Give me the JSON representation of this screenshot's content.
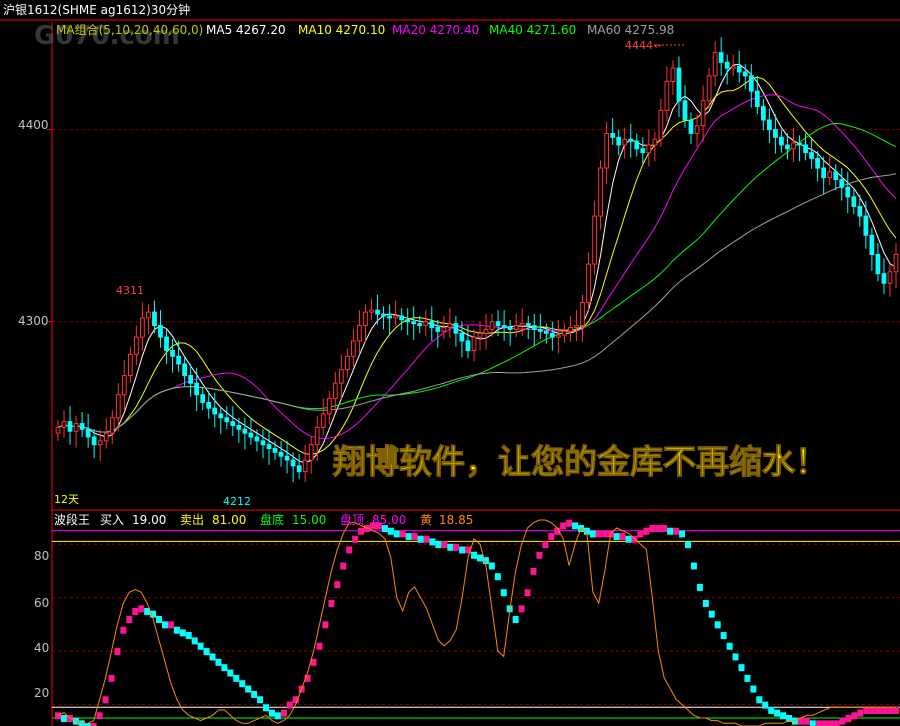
{
  "title_bar": {
    "title": "沪银1612(SHME ag1612)30分钟",
    "watermark": "G070.com"
  },
  "ma_legend": [
    {
      "label": "MA组合(5,10,20,40,60,0)",
      "color": "#c8c800"
    },
    {
      "label": "MA5 4267.20",
      "color": "#ffffff"
    },
    {
      "label": "MA10 4270.10",
      "color": "#ffff00"
    },
    {
      "label": "MA20 4270.40",
      "color": "#ff00ff"
    },
    {
      "label": "MA40 4271.60",
      "color": "#00ff00"
    },
    {
      "label": "MA60 4275.98",
      "color": "#a0a0a0"
    }
  ],
  "main_panel": {
    "y_ticks": [
      "4400",
      "4300"
    ],
    "high_label": "4444",
    "left_high_label": "4311",
    "low_label": "4212",
    "period_label": "12天",
    "slogan": "翔博软件，让您的金库不再缩水！"
  },
  "sub_panel": {
    "name": "波段王",
    "params": [
      {
        "label": "买入",
        "value": "19.00",
        "color": "#ffffff"
      },
      {
        "label": "卖出",
        "value": "81.00",
        "color": "#ffff00"
      },
      {
        "label": "盘底",
        "value": "15.00",
        "color": "#00ff00"
      },
      {
        "label": "盘顶",
        "value": "85.00",
        "color": "#ff00ff"
      },
      {
        "label": "黄",
        "value": "18.85",
        "color": "#ff8800"
      }
    ],
    "y_ticks": [
      "80",
      "60",
      "40",
      "20"
    ]
  },
  "colors": {
    "up": "#ff3232",
    "down": "#00ffff",
    "grid": "#8b0000",
    "axis": "#ff0000",
    "ma5": "#ffffff",
    "ma10": "#ffff00",
    "ma20": "#ff00ff",
    "ma40": "#00ff00",
    "ma60": "#a0a0a0",
    "osc_up": "#ff1493",
    "osc_down": "#00ffff",
    "osc_line": "#ff8800",
    "slogan": "#ffff00"
  },
  "chart_data": [
    {
      "type": "candlestick",
      "title": "沪银1612(SHME ag1612)30分钟",
      "ylim": [
        4202,
        4456
      ],
      "y_ticks": [
        4300,
        4400
      ],
      "key_levels": {
        "high": 4444,
        "local_high": 4311,
        "low": 4212
      },
      "closes": [
        4245,
        4248,
        4243,
        4247,
        4244,
        4240,
        4236,
        4238,
        4242,
        4250,
        4262,
        4272,
        4283,
        4292,
        4302,
        4305,
        4298,
        4292,
        4285,
        4282,
        4278,
        4272,
        4268,
        4262,
        4258,
        4255,
        4252,
        4250,
        4248,
        4246,
        4244,
        4242,
        4240,
        4238,
        4236,
        4234,
        4232,
        4230,
        4228,
        4225,
        4222,
        4228,
        4236,
        4245,
        4252,
        4260,
        4268,
        4275,
        4282,
        4290,
        4298,
        4305,
        4306,
        4304,
        4303,
        4302,
        4303,
        4301,
        4300,
        4299,
        4298,
        4300,
        4297,
        4295,
        4297,
        4299,
        4294,
        4290,
        4285,
        4292,
        4294,
        4296,
        4300,
        4298,
        4297,
        4296,
        4298,
        4299,
        4298,
        4296,
        4295,
        4294,
        4292,
        4293,
        4295,
        4297,
        4298,
        4310,
        4330,
        4355,
        4380,
        4398,
        4396,
        4392,
        4395,
        4394,
        4390,
        4388,
        4392,
        4395,
        4410,
        4425,
        4432,
        4415,
        4405,
        4398,
        4402,
        4415,
        4428,
        4440,
        4435,
        4432,
        4433,
        4430,
        4428,
        4420,
        4412,
        4405,
        4400,
        4396,
        4392,
        4390,
        4393,
        4392,
        4388,
        4385,
        4380,
        4375,
        4378,
        4374,
        4370,
        4365,
        4360,
        4355,
        4345,
        4335,
        4325,
        4320,
        4326,
        4335
      ],
      "ma_series": [
        "MA5",
        "MA10",
        "MA20",
        "MA40",
        "MA60"
      ],
      "ma_values": {
        "MA5": 4267.2,
        "MA10": 4270.1,
        "MA20": 4270.4,
        "MA40": 4271.6,
        "MA60": 4275.98
      }
    },
    {
      "type": "bar",
      "title": "波段王",
      "ylim": [
        12,
        92
      ],
      "y_ticks": [
        20,
        40,
        60,
        80
      ],
      "reference_lines": {
        "买入": 19,
        "卖出": 81,
        "盘底": 15,
        "盘顶": 85
      },
      "yellow_value": 18.85,
      "values": [
        16,
        15,
        15,
        14,
        13,
        12,
        12,
        16,
        22,
        30,
        40,
        48,
        52,
        55,
        56,
        55,
        54,
        52,
        50,
        50,
        48,
        47,
        46,
        44,
        42,
        40,
        38,
        36,
        34,
        32,
        30,
        28,
        26,
        24,
        22,
        19,
        17,
        16,
        17,
        20,
        22,
        26,
        30,
        36,
        42,
        50,
        58,
        65,
        72,
        78,
        82,
        85,
        86,
        87,
        87,
        86,
        85,
        84,
        84,
        83,
        83,
        82,
        82,
        81,
        80,
        80,
        79,
        79,
        78,
        78,
        76,
        75,
        74,
        72,
        68,
        62,
        56,
        52,
        56,
        62,
        70,
        76,
        80,
        83,
        85,
        87,
        88,
        87,
        86,
        85,
        84,
        84,
        84,
        84,
        83,
        83,
        82,
        82,
        84,
        85,
        86,
        86,
        86,
        85,
        85,
        84,
        80,
        72,
        64,
        58,
        54,
        50,
        46,
        42,
        38,
        34,
        30,
        26,
        22,
        20,
        18,
        17,
        16,
        15,
        14,
        14,
        14,
        13,
        13,
        13,
        13,
        13,
        14,
        15,
        16,
        17,
        18,
        18,
        18,
        18,
        18,
        18
      ],
      "line": [
        16,
        17,
        15,
        14,
        13,
        13,
        14,
        22,
        30,
        40,
        50,
        58,
        62,
        63,
        62,
        58,
        52,
        44,
        36,
        28,
        22,
        18,
        16,
        15,
        14,
        15,
        16,
        18,
        18,
        16,
        14,
        13,
        13,
        14,
        15,
        16,
        14,
        13,
        14,
        16,
        20,
        26,
        32,
        40,
        50,
        60,
        70,
        78,
        84,
        88,
        88,
        87,
        86,
        85,
        84,
        82,
        75,
        60,
        55,
        62,
        64,
        60,
        56,
        50,
        44,
        42,
        44,
        48,
        60,
        75,
        82,
        80,
        72,
        56,
        40,
        38,
        55,
        70,
        80,
        86,
        88,
        89,
        89,
        88,
        86,
        82,
        72,
        80,
        86,
        84,
        62,
        58,
        70,
        84,
        86,
        85,
        84,
        82,
        80,
        78,
        60,
        40,
        30,
        26,
        22,
        20,
        18,
        16,
        15,
        15,
        14,
        14,
        13,
        13,
        13,
        12,
        12,
        12,
        12,
        13,
        13,
        13,
        13,
        14,
        14,
        15,
        16,
        16,
        17,
        18,
        19,
        19,
        19,
        19,
        19,
        19,
        19,
        19,
        19,
        19,
        19,
        19
      ]
    }
  ]
}
